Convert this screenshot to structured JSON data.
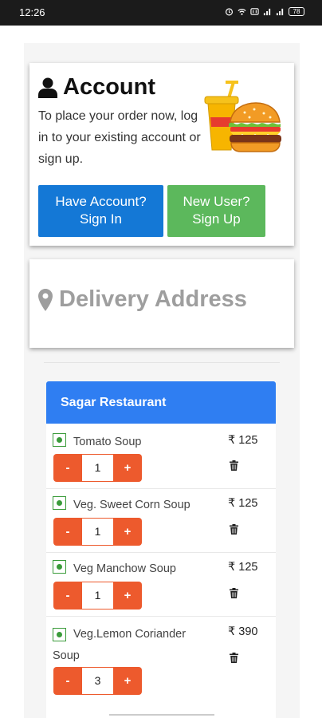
{
  "status_bar": {
    "time": "12:26",
    "battery": "78"
  },
  "account": {
    "title": "Account",
    "description": "To place your order now, log in to your existing account or sign up.",
    "signin_label_line1": "Have Account?",
    "signin_label_line2": "Sign In",
    "signup_label_line1": "New User?",
    "signup_label_line2": "Sign Up",
    "icon": "user-icon"
  },
  "address": {
    "title": "Delivery Address",
    "icon": "map-marker-icon"
  },
  "cart": {
    "restaurant": "Sagar Restaurant",
    "items": [
      {
        "name": "Tomato Soup",
        "price": "₹ 125",
        "qty": "1"
      },
      {
        "name": "Veg. Sweet Corn Soup",
        "price": "₹ 125",
        "qty": "1"
      },
      {
        "name": "Veg Manchow Soup",
        "price": "₹ 125",
        "qty": "1"
      },
      {
        "name": "Veg.Lemon Coriander Soup",
        "price": "₹ 390",
        "qty": "3"
      }
    ],
    "minus_label": "-",
    "plus_label": "+"
  },
  "colors": {
    "primary_blue": "#1478d6",
    "signup_green": "#5cb85c",
    "restaurant_header": "#2f7ef2",
    "stepper_orange": "#ed5a2d",
    "veg_green": "#3a9b3a"
  }
}
